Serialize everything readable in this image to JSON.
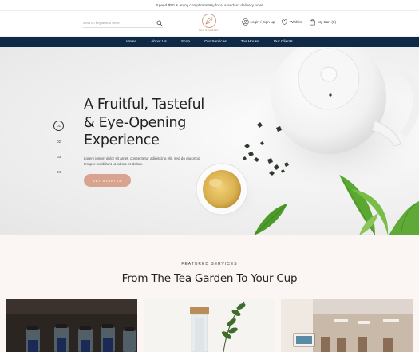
{
  "topbar": {
    "text": "Spend $50 & enjoy complimentary local standard delivery now!"
  },
  "header": {
    "search_placeholder": "Search keywords here",
    "logo_text": "TEA CHAMBER",
    "login_label": "Login / Sign up",
    "wishlist_label": "Wishlist",
    "cart_label": "My Cart (0)"
  },
  "nav": {
    "items": [
      {
        "label": "Home"
      },
      {
        "label": "About Us"
      },
      {
        "label": "Shop"
      },
      {
        "label": "Our Services"
      },
      {
        "label": "Tea House"
      },
      {
        "label": "Our Clients"
      }
    ]
  },
  "hero": {
    "title_line1": "A Fruitful, Tasteful",
    "title_line2": "& Eye-Opening",
    "title_line3": "Experience",
    "description": "Lorem ipsum dolor sit amet, consectetur adipiscing elit, sed do eiusmod tempor incididunt ut labore et dolore.",
    "button_label": "GET STARTED",
    "slides": [
      "01",
      "02",
      "03",
      "04"
    ],
    "active_slide": "01"
  },
  "featured": {
    "eyebrow": "FEATURED SERVICES",
    "heading": "From The Tea Garden To Your Cup"
  },
  "colors": {
    "nav_bg": "#0e2a47",
    "accent": "#d9a48f",
    "featured_bg": "#fbf6f4"
  }
}
